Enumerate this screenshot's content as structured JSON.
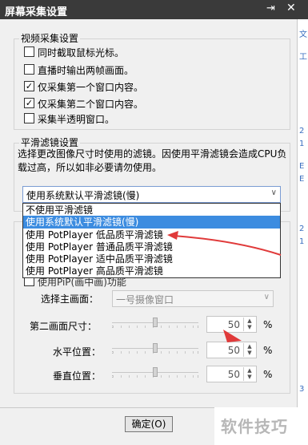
{
  "window": {
    "title": "屏幕采集设置",
    "pin_symbol": "⇥",
    "close_symbol": "✕"
  },
  "right_strip_glyphs": [
    "文",
    "工",
    "2",
    "1",
    "E",
    "E",
    "2",
    "1",
    "3"
  ],
  "video_capture": {
    "legend": "视频采集设置",
    "options": [
      {
        "label": "同时截取鼠标光标。",
        "checked": false
      },
      {
        "label": "直播时输出两帧画面。",
        "checked": false
      },
      {
        "label": "仅采集第一个窗口内容。",
        "checked": true
      },
      {
        "label": "仅采集第二个窗口内容。",
        "checked": true
      },
      {
        "label": "采集半透明窗口。",
        "checked": false
      }
    ]
  },
  "smooth_filter": {
    "legend": "平滑滤镜设置",
    "description": "选择更改图像尺寸时使用的滤镜。因使用平滑滤镜会造成CPU负载过高，所以如非必要请勿使用。",
    "selected": "使用系统默认平滑滤镜(慢)",
    "options": [
      "不使用平滑滤镜",
      "使用系统默认平滑滤镜(慢)",
      "使用 PotPlayer 低品质平滑滤镜",
      "使用 PotPlayer 普通品质平滑滤镜",
      "使用 PotPlayer 适中品质平滑滤镜",
      "使用 PotPlayer 高品质平滑滤镜"
    ],
    "highlighted_index": 1
  },
  "pip": {
    "partial_checkbox_label": "使用PiP(画中画)功能",
    "main_screen_label": "选择主画面：",
    "main_screen_value": "一号摄像窗口",
    "rows": [
      {
        "label": "第二画面尺寸：",
        "value": "50",
        "unit": "%",
        "slider": 0.5
      },
      {
        "label": "水平位置：",
        "value": "50",
        "unit": "%",
        "slider": 0.5
      },
      {
        "label": "垂直位置：",
        "value": "50",
        "unit": "%",
        "slider": 0.5
      }
    ]
  },
  "ok_button": "确定(O)",
  "watermark": "软件技巧",
  "colors": {
    "titlebar": "#3a3a3a",
    "selection": "#3c8ce0",
    "annotation_arrow": "#e03a3a"
  }
}
